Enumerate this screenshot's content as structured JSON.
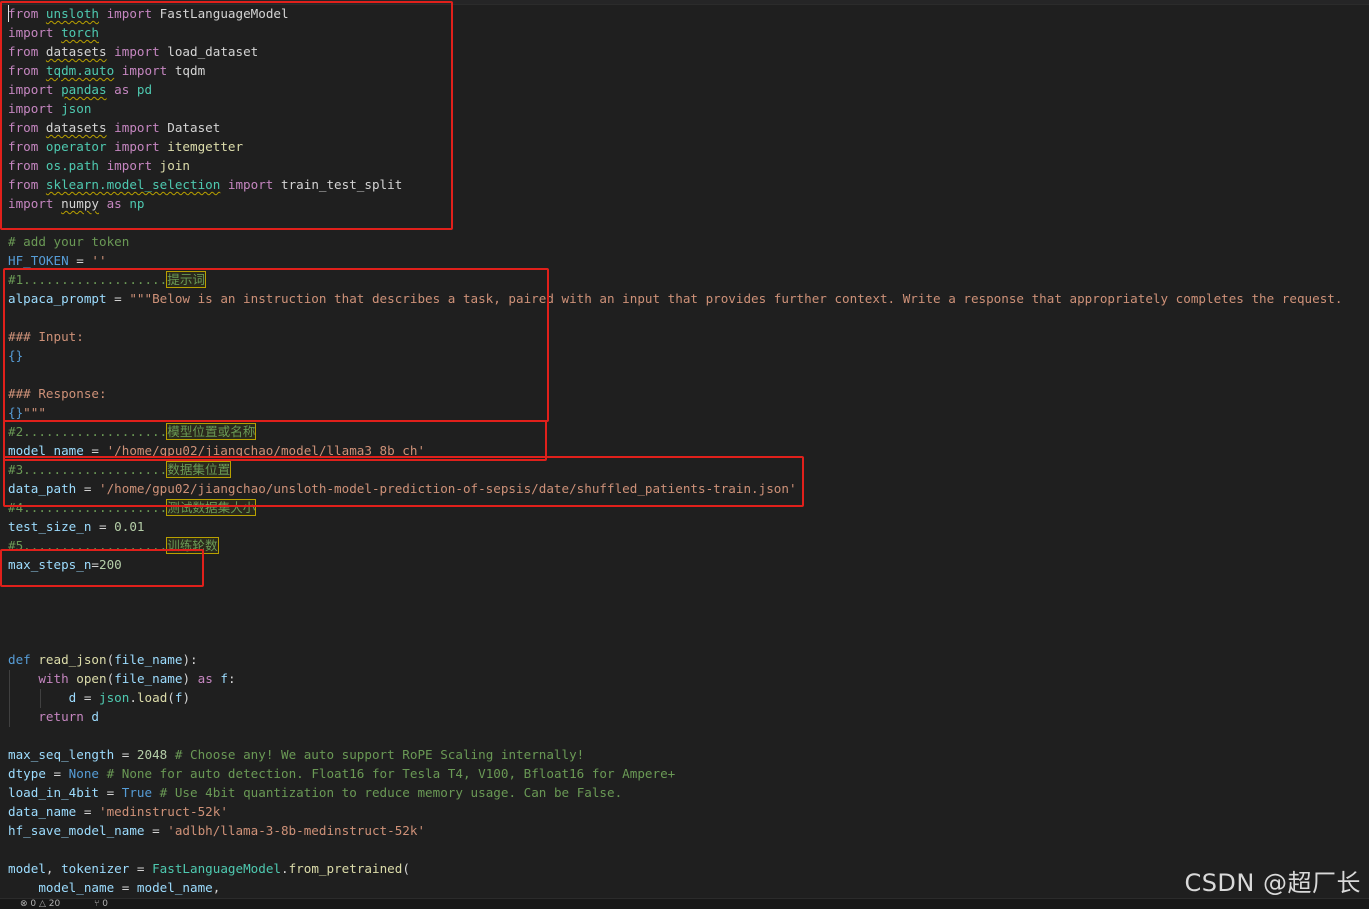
{
  "code_lines": [
    {
      "row": 0,
      "tokens": [
        [
          "kw",
          "from "
        ],
        [
          "squig mod",
          "unsloth"
        ],
        [
          "kw",
          " import "
        ],
        [
          "plain",
          "FastLanguageModel"
        ]
      ]
    },
    {
      "row": 1,
      "tokens": [
        [
          "kw",
          "import "
        ],
        [
          "squig mod",
          "torch"
        ]
      ]
    },
    {
      "row": 2,
      "tokens": [
        [
          "kw",
          "from "
        ],
        [
          "squig plain",
          "datasets"
        ],
        [
          "kw",
          " import "
        ],
        [
          "plain",
          "load_dataset"
        ]
      ]
    },
    {
      "row": 3,
      "tokens": [
        [
          "kw",
          "from "
        ],
        [
          "squig mod",
          "tqdm.auto"
        ],
        [
          "kw",
          " import "
        ],
        [
          "plain",
          "tqdm"
        ]
      ]
    },
    {
      "row": 4,
      "tokens": [
        [
          "kw",
          "import "
        ],
        [
          "squig mod",
          "pandas"
        ],
        [
          "kw",
          " as "
        ],
        [
          "mod",
          "pd"
        ]
      ]
    },
    {
      "row": 5,
      "tokens": [
        [
          "kw",
          "import "
        ],
        [
          "mod",
          "json"
        ]
      ]
    },
    {
      "row": 6,
      "tokens": [
        [
          "kw",
          "from "
        ],
        [
          "squig plain",
          "datasets"
        ],
        [
          "kw",
          " import "
        ],
        [
          "plain",
          "Dataset"
        ]
      ]
    },
    {
      "row": 7,
      "tokens": [
        [
          "kw",
          "from "
        ],
        [
          "mod",
          "operator"
        ],
        [
          "kw",
          " import "
        ],
        [
          "fn",
          "itemgetter"
        ]
      ]
    },
    {
      "row": 8,
      "tokens": [
        [
          "kw",
          "from "
        ],
        [
          "mod",
          "os.path"
        ],
        [
          "kw",
          " import "
        ],
        [
          "fn",
          "join"
        ]
      ]
    },
    {
      "row": 9,
      "tokens": [
        [
          "kw",
          "from "
        ],
        [
          "squig mod",
          "sklearn.model_selection"
        ],
        [
          "kw",
          " import "
        ],
        [
          "plain",
          "train_test_split"
        ]
      ]
    },
    {
      "row": 10,
      "tokens": [
        [
          "kw",
          "import "
        ],
        [
          "squig plain",
          "numpy"
        ],
        [
          "kw",
          " as "
        ],
        [
          "mod",
          "np"
        ]
      ]
    },
    {
      "row": 12,
      "tokens": [
        [
          "cm",
          "# add your token"
        ]
      ]
    },
    {
      "row": 13,
      "tokens": [
        [
          "kb",
          "HF_TOKEN"
        ],
        [
          "plain",
          " = "
        ],
        [
          "str",
          "''"
        ]
      ]
    },
    {
      "row": 14,
      "tokens": [
        [
          "cm",
          "#1..................."
        ],
        [
          "hl",
          "提示词"
        ]
      ]
    },
    {
      "row": 15,
      "tokens": [
        [
          "var",
          "alpaca_prompt"
        ],
        [
          "plain",
          " = "
        ],
        [
          "str",
          "\"\"\"Below is an instruction that describes a task, paired with an input that provides further context. Write a response that appropriately completes the request."
        ]
      ]
    },
    {
      "row": 17,
      "tokens": [
        [
          "str",
          "### Input:"
        ]
      ]
    },
    {
      "row": 18,
      "tokens": [
        [
          "kb",
          "{}"
        ]
      ]
    },
    {
      "row": 20,
      "tokens": [
        [
          "str",
          "### Response:"
        ]
      ]
    },
    {
      "row": 21,
      "tokens": [
        [
          "kb",
          "{}"
        ],
        [
          "str",
          "\"\"\""
        ]
      ]
    },
    {
      "row": 22,
      "tokens": [
        [
          "cm",
          "#2..................."
        ],
        [
          "hl",
          "模型位置或名称"
        ]
      ]
    },
    {
      "row": 23,
      "tokens": [
        [
          "var",
          "model_name"
        ],
        [
          "plain",
          " = "
        ],
        [
          "str",
          "'/home/gpu02/jiangchao/model/llama3_8b_ch'"
        ]
      ]
    },
    {
      "row": 24,
      "tokens": [
        [
          "cm",
          "#3..................."
        ],
        [
          "hl",
          "数据集位置"
        ]
      ]
    },
    {
      "row": 25,
      "tokens": [
        [
          "var",
          "data_path"
        ],
        [
          "plain",
          " = "
        ],
        [
          "str",
          "'/home/gpu02/jiangchao/unsloth-model-prediction-of-sepsis/date/shuffled_patients-train.json'"
        ]
      ]
    },
    {
      "row": 26,
      "tokens": [
        [
          "cm",
          "#4..................."
        ],
        [
          "hl",
          "测试数据集大小"
        ]
      ]
    },
    {
      "row": 27,
      "tokens": [
        [
          "var",
          "test_size_n"
        ],
        [
          "plain",
          " = "
        ],
        [
          "num",
          "0.01"
        ]
      ]
    },
    {
      "row": 28,
      "tokens": [
        [
          "cm",
          "#5..................."
        ],
        [
          "hl",
          "训练轮数"
        ]
      ]
    },
    {
      "row": 29,
      "tokens": [
        [
          "var",
          "max_steps_n"
        ],
        [
          "plain",
          "="
        ],
        [
          "num",
          "200"
        ]
      ]
    },
    {
      "row": 34,
      "tokens": [
        [
          "kb",
          "def "
        ],
        [
          "fn",
          "read_json"
        ],
        [
          "plain",
          "("
        ],
        [
          "var",
          "file_name"
        ],
        [
          "plain",
          "):"
        ]
      ]
    },
    {
      "row": 35,
      "tokens": [
        [
          "plain",
          "    "
        ],
        [
          "kw",
          "with "
        ],
        [
          "fn",
          "open"
        ],
        [
          "plain",
          "("
        ],
        [
          "var",
          "file_name"
        ],
        [
          "plain",
          ") "
        ],
        [
          "kw",
          "as "
        ],
        [
          "var",
          "f"
        ],
        [
          "plain",
          ":"
        ]
      ]
    },
    {
      "row": 36,
      "tokens": [
        [
          "plain",
          "        "
        ],
        [
          "var",
          "d"
        ],
        [
          "plain",
          " = "
        ],
        [
          "mod",
          "json"
        ],
        [
          "plain",
          "."
        ],
        [
          "fn",
          "load"
        ],
        [
          "plain",
          "("
        ],
        [
          "var",
          "f"
        ],
        [
          "plain",
          ")"
        ]
      ]
    },
    {
      "row": 37,
      "tokens": [
        [
          "plain",
          "    "
        ],
        [
          "kw",
          "return "
        ],
        [
          "var",
          "d"
        ]
      ]
    },
    {
      "row": 39,
      "tokens": [
        [
          "var",
          "max_seq_length"
        ],
        [
          "plain",
          " = "
        ],
        [
          "num",
          "2048"
        ],
        [
          "cm",
          " # Choose any! We auto support RoPE Scaling internally!"
        ]
      ]
    },
    {
      "row": 40,
      "tokens": [
        [
          "var",
          "dtype"
        ],
        [
          "plain",
          " = "
        ],
        [
          "kb",
          "None"
        ],
        [
          "cm",
          " # None for auto detection. Float16 for Tesla T4, V100, Bfloat16 for Ampere+"
        ]
      ]
    },
    {
      "row": 41,
      "tokens": [
        [
          "var",
          "load_in_4bit"
        ],
        [
          "plain",
          " = "
        ],
        [
          "kb",
          "True"
        ],
        [
          "cm",
          " # Use 4bit quantization to reduce memory usage. Can be False."
        ]
      ]
    },
    {
      "row": 42,
      "tokens": [
        [
          "var",
          "data_name"
        ],
        [
          "plain",
          " = "
        ],
        [
          "str",
          "'medinstruct-52k'"
        ]
      ]
    },
    {
      "row": 43,
      "tokens": [
        [
          "var",
          "hf_save_model_name"
        ],
        [
          "plain",
          " = "
        ],
        [
          "str",
          "'adlbh/llama-3-8b-medinstruct-52k'"
        ]
      ]
    },
    {
      "row": 45,
      "tokens": [
        [
          "var",
          "model"
        ],
        [
          "plain",
          ", "
        ],
        [
          "var",
          "tokenizer"
        ],
        [
          "plain",
          " = "
        ],
        [
          "mod",
          "FastLanguageModel"
        ],
        [
          "plain",
          "."
        ],
        [
          "fn",
          "from_pretrained"
        ],
        [
          "plain",
          "("
        ]
      ]
    },
    {
      "row": 46,
      "tokens": [
        [
          "plain",
          "    "
        ],
        [
          "var",
          "model_name"
        ],
        [
          "plain",
          " = "
        ],
        [
          "var",
          "model_name"
        ],
        [
          "plain",
          ","
        ]
      ]
    }
  ],
  "status_bar": {
    "errors": "0",
    "warnings": "20",
    "ports": "0"
  },
  "watermark": "CSDN @超厂长"
}
